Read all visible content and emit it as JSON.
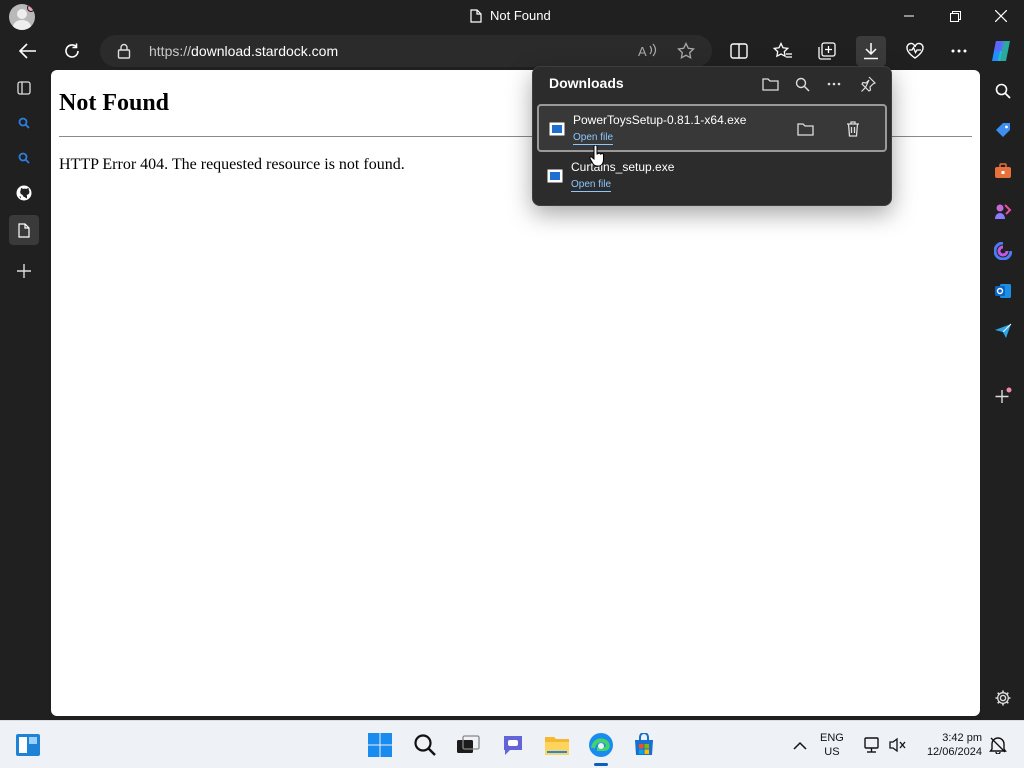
{
  "window": {
    "tab_title": "Not Found"
  },
  "toolbar": {
    "url_scheme": "https://",
    "url_host": "download.stardock.com",
    "icons": [
      "back-icon",
      "refresh-icon",
      "lock-icon",
      "read-aloud-icon",
      "favorite-star-icon",
      "split-screen-icon",
      "favorites-icon",
      "collections-icon",
      "download-icon",
      "browser-essentials-icon",
      "more-icon",
      "copilot-icon"
    ]
  },
  "page": {
    "heading": "Not Found",
    "message": "HTTP Error 404. The requested resource is not found."
  },
  "downloads": {
    "title": "Downloads",
    "items": [
      {
        "filename": "PowerToysSetup-0.81.1-x64.exe",
        "action": "Open file"
      },
      {
        "filename": "Curtains_setup.exe",
        "action": "Open file"
      }
    ]
  },
  "taskbar": {
    "lang_line1": "ENG",
    "lang_line2": "US",
    "time": "3:42 pm",
    "date": "12/06/2024"
  },
  "colors": {
    "browser_chrome": "#202020",
    "flyout_bg": "#2c2c2c",
    "link": "#8cc8ff",
    "taskbar": "#eef1f6",
    "accent": "#0a5fc2"
  }
}
